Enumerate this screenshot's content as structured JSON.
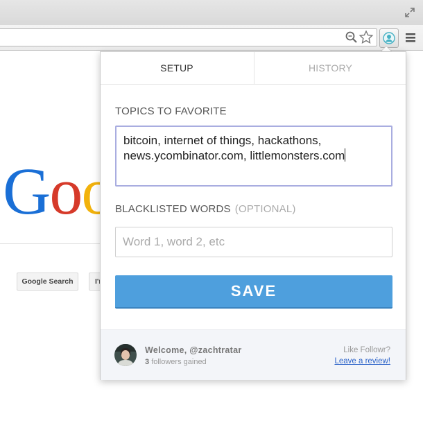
{
  "google": {
    "logo_letters": [
      "G",
      "o",
      "o"
    ],
    "search_button": "Google Search",
    "lucky_button": "I'm Feeling Lucky"
  },
  "popup": {
    "tabs": {
      "setup": "SETUP",
      "history": "HISTORY",
      "active": "setup"
    },
    "topics": {
      "label": "TOPICS TO FAVORITE",
      "value": "bitcoin, internet of things, hackathons, news.ycombinator.com, littlemonsters.com"
    },
    "blacklist": {
      "label": "BLACKLISTED WORDS",
      "optional": "(OPTIONAL)",
      "placeholder": "Word 1, word 2, etc"
    },
    "save_label": "SAVE",
    "footer": {
      "welcome": "Welcome, @zachtratar",
      "follower_count": "3",
      "followers_text": "followers gained",
      "like_text": "Like Followr?",
      "review_link": "Leave a review!"
    }
  },
  "icons": {
    "window": "expand-icon",
    "omnibox": [
      "zoom-icon",
      "star-icon"
    ],
    "extension": "followr-extension-icon",
    "menu": "hamburger-menu-icon"
  },
  "colors": {
    "save_button": "#4e9fdd",
    "focus_border": "#a9ade0",
    "link": "#2a62c8",
    "footer_bg": "#f3f5f9"
  }
}
